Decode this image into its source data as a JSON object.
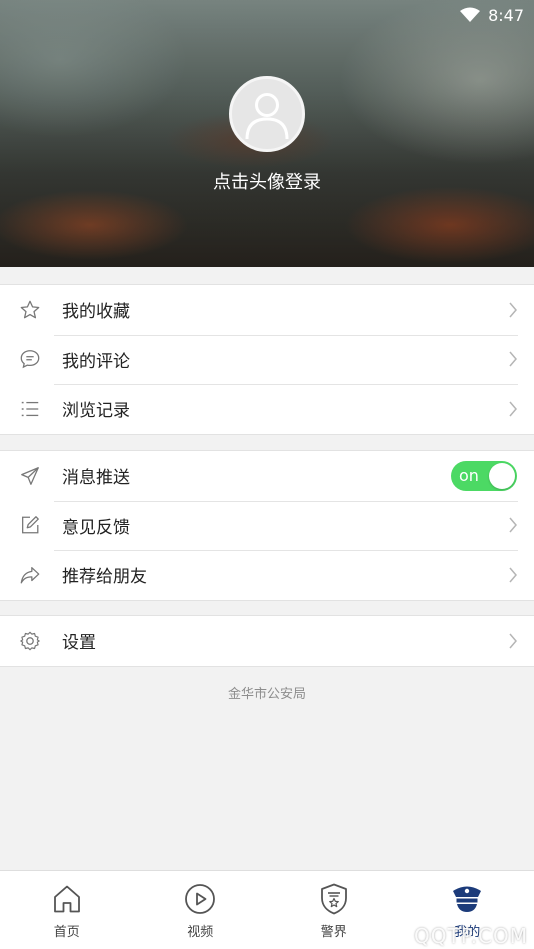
{
  "status_bar": {
    "time": "8:47"
  },
  "profile": {
    "login_prompt": "点击头像登录"
  },
  "menu_groups": [
    {
      "items": [
        {
          "label": "我的收藏",
          "icon": "star-icon"
        },
        {
          "label": "我的评论",
          "icon": "comment-icon"
        },
        {
          "label": "浏览记录",
          "icon": "list-icon"
        }
      ]
    },
    {
      "items": [
        {
          "label": "消息推送",
          "icon": "send-icon",
          "toggle": "on"
        },
        {
          "label": "意见反馈",
          "icon": "edit-icon"
        },
        {
          "label": "推荐给朋友",
          "icon": "share-icon"
        }
      ]
    },
    {
      "items": [
        {
          "label": "设置",
          "icon": "gear-icon"
        }
      ]
    }
  ],
  "footer_note": "金华市公安局",
  "bottom_nav": [
    {
      "label": "首页",
      "icon": "home-icon"
    },
    {
      "label": "视频",
      "icon": "play-icon"
    },
    {
      "label": "警界",
      "icon": "police-badge-icon"
    },
    {
      "label": "我的",
      "icon": "police-cap-icon",
      "active": true
    }
  ],
  "watermark": "QQTP.COM",
  "colors": {
    "toggle_on": "#4cd964",
    "active_nav": "#1c3b7a"
  }
}
